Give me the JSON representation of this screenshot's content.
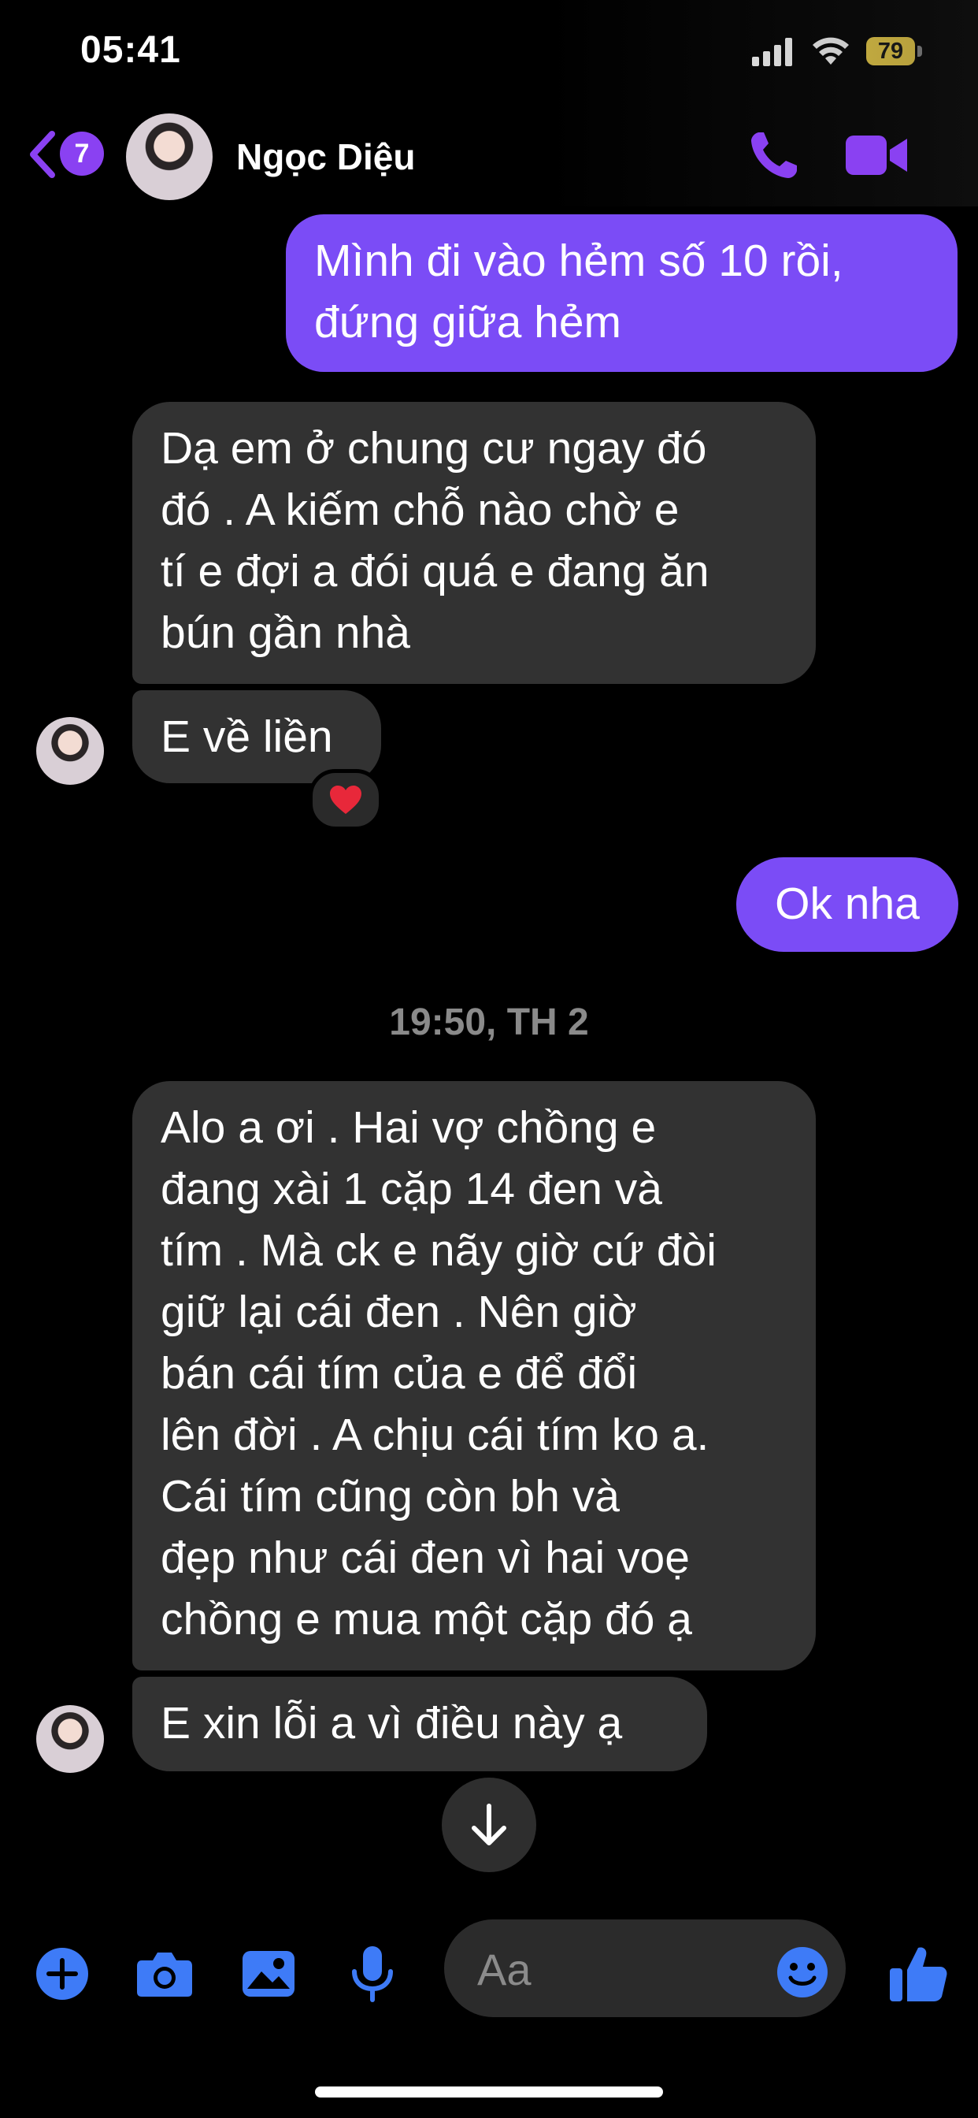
{
  "status_bar": {
    "time": "05:41",
    "battery": "79"
  },
  "header": {
    "back_badge": "7",
    "contact_name": "Ngọc Diệu"
  },
  "messages": [
    {
      "side": "sent",
      "text": "Mình đi vào hẻm số 10 rồi,\nđứng giữa hẻm"
    },
    {
      "side": "received",
      "text": "Dạ em ở chung cư ngay đó\nđó . A kiếm chỗ nào chờ e\ntí e đợi a đói quá e đang ăn\nbún gần nhà"
    },
    {
      "side": "received",
      "text": "E về liền",
      "reaction": "❤️"
    },
    {
      "side": "sent",
      "text": "Ok nha"
    },
    {
      "side": "received",
      "text": "Alo a ơi . Hai vợ chồng e\nđang xài 1 cặp 14 đen và\ntím . Mà ck e nãy giờ cứ đòi\ngiữ lại cái đen . Nên giờ\nbán cái tím của e để đổi\nlên đời . A chịu cái tím ko a.\nCái tím cũng còn bh và\nđẹp như cái đen vì hai voẹ\nchồng e mua một cặp đó ạ"
    },
    {
      "side": "received",
      "text": "E xin lỗi a vì điều này ạ"
    }
  ],
  "timestamp": "19:50, TH 2",
  "composer": {
    "placeholder": "Aa"
  },
  "icons": {
    "header": [
      "back-chevron-icon",
      "phone-icon",
      "video-camera-icon"
    ],
    "composer": [
      "plus-icon",
      "camera-icon",
      "gallery-icon",
      "microphone-icon",
      "emoji-icon",
      "thumbs-up-icon"
    ]
  },
  "colors": {
    "accent": "#8a41f2",
    "sent_bubble": "#7b4cf6",
    "received_bubble": "#323232",
    "composer_icon": "#3e7bf7",
    "battery": "#f5d547"
  }
}
